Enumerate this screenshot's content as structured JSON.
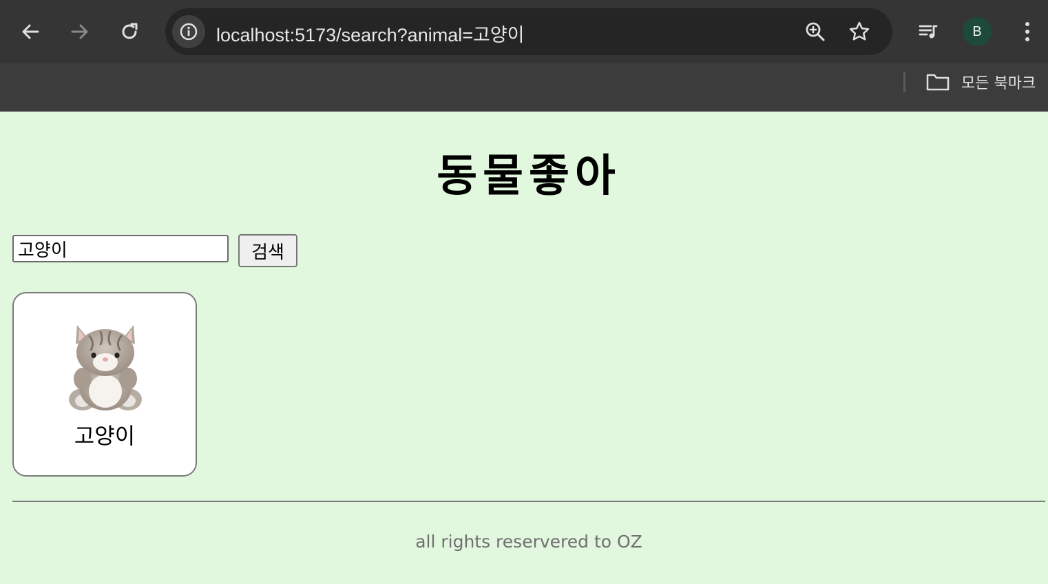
{
  "browser": {
    "url": "localhost:5173/search?animal=고양이",
    "profile_initial": "B",
    "bookmarks_folder_label": "모든 북마크",
    "icons": {
      "back": "arrow-left-icon",
      "forward": "arrow-right-icon",
      "reload": "reload-icon",
      "site_info": "info-icon",
      "zoom": "zoom-in-icon",
      "bookmark_star": "star-icon",
      "media": "playlist-icon",
      "menu": "kebab-menu-icon",
      "folder": "folder-icon"
    }
  },
  "page": {
    "title": "동물좋아",
    "background_color": "#e1f7de",
    "search": {
      "value": "고양이",
      "button_label": "검색"
    },
    "results": [
      {
        "label": "고양이",
        "image": "plush-cat-image"
      }
    ],
    "footer": "all rights reservered to OZ"
  }
}
